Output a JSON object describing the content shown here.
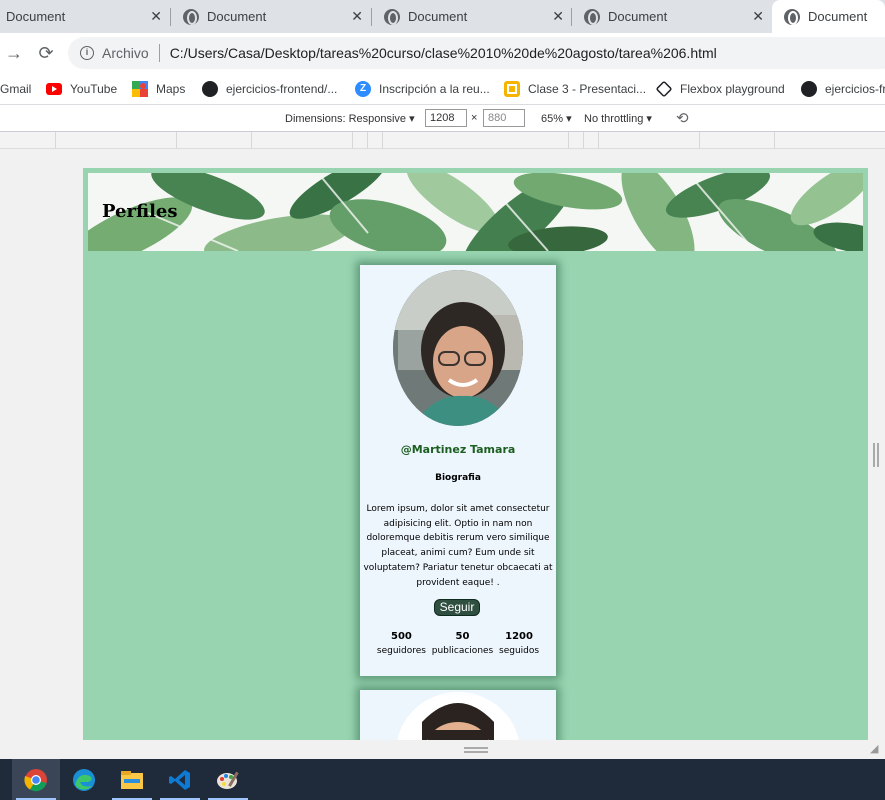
{
  "browser": {
    "tabs": [
      {
        "title": "Document",
        "active": false
      },
      {
        "title": "Document",
        "active": false
      },
      {
        "title": "Document",
        "active": false
      },
      {
        "title": "Document",
        "active": false
      },
      {
        "title": "Document",
        "active": true
      }
    ],
    "scheme_label": "Archivo",
    "url": "C:/Users/Casa/Desktop/tareas%20curso/clase%2010%20de%20agosto/tarea%206.html",
    "bookmarks": [
      {
        "label": "Gmail",
        "icon": "gmail-icon"
      },
      {
        "label": "YouTube",
        "icon": "youtube-icon"
      },
      {
        "label": "Maps",
        "icon": "maps-icon"
      },
      {
        "label": "ejercicios-frontend/...",
        "icon": "github-icon"
      },
      {
        "label": "Inscripción a la reu...",
        "icon": "zoom-icon"
      },
      {
        "label": "Clase 3 - Presentaci...",
        "icon": "slides-icon"
      },
      {
        "label": "Flexbox playground",
        "icon": "codepen-icon"
      },
      {
        "label": "ejercicios-fr",
        "icon": "github-icon"
      }
    ]
  },
  "devtools": {
    "dimensions_label": "Dimensions: Responsive",
    "width_value": "1208",
    "height_placeholder": "880",
    "times": "×",
    "zoom": "65%",
    "throttling": "No throttling"
  },
  "page": {
    "title": "Perfiles",
    "card": {
      "username": "@Martinez Tamara",
      "bio_title": "Biografia",
      "bio_text": "Lorem ipsum, dolor sit amet consectetur adipisicing elit. Optio in nam non doloremque debitis rerum vero similique placeat, animi cum? Eum unde sit voluptatem? Pariatur tenetur obcaecati at provident eaque! .",
      "follow_label": "Seguir",
      "stats": [
        {
          "value": "500",
          "label": "seguidores"
        },
        {
          "value": "50",
          "label": "publicaciones"
        },
        {
          "value": "1200",
          "label": "seguidos"
        }
      ]
    }
  },
  "taskbar": {
    "apps": [
      {
        "name": "chrome-icon",
        "active": true
      },
      {
        "name": "edge-icon",
        "active": false
      },
      {
        "name": "file-explorer-icon",
        "active": false
      },
      {
        "name": "vscode-icon",
        "active": false
      },
      {
        "name": "paint-icon",
        "active": false
      }
    ]
  }
}
